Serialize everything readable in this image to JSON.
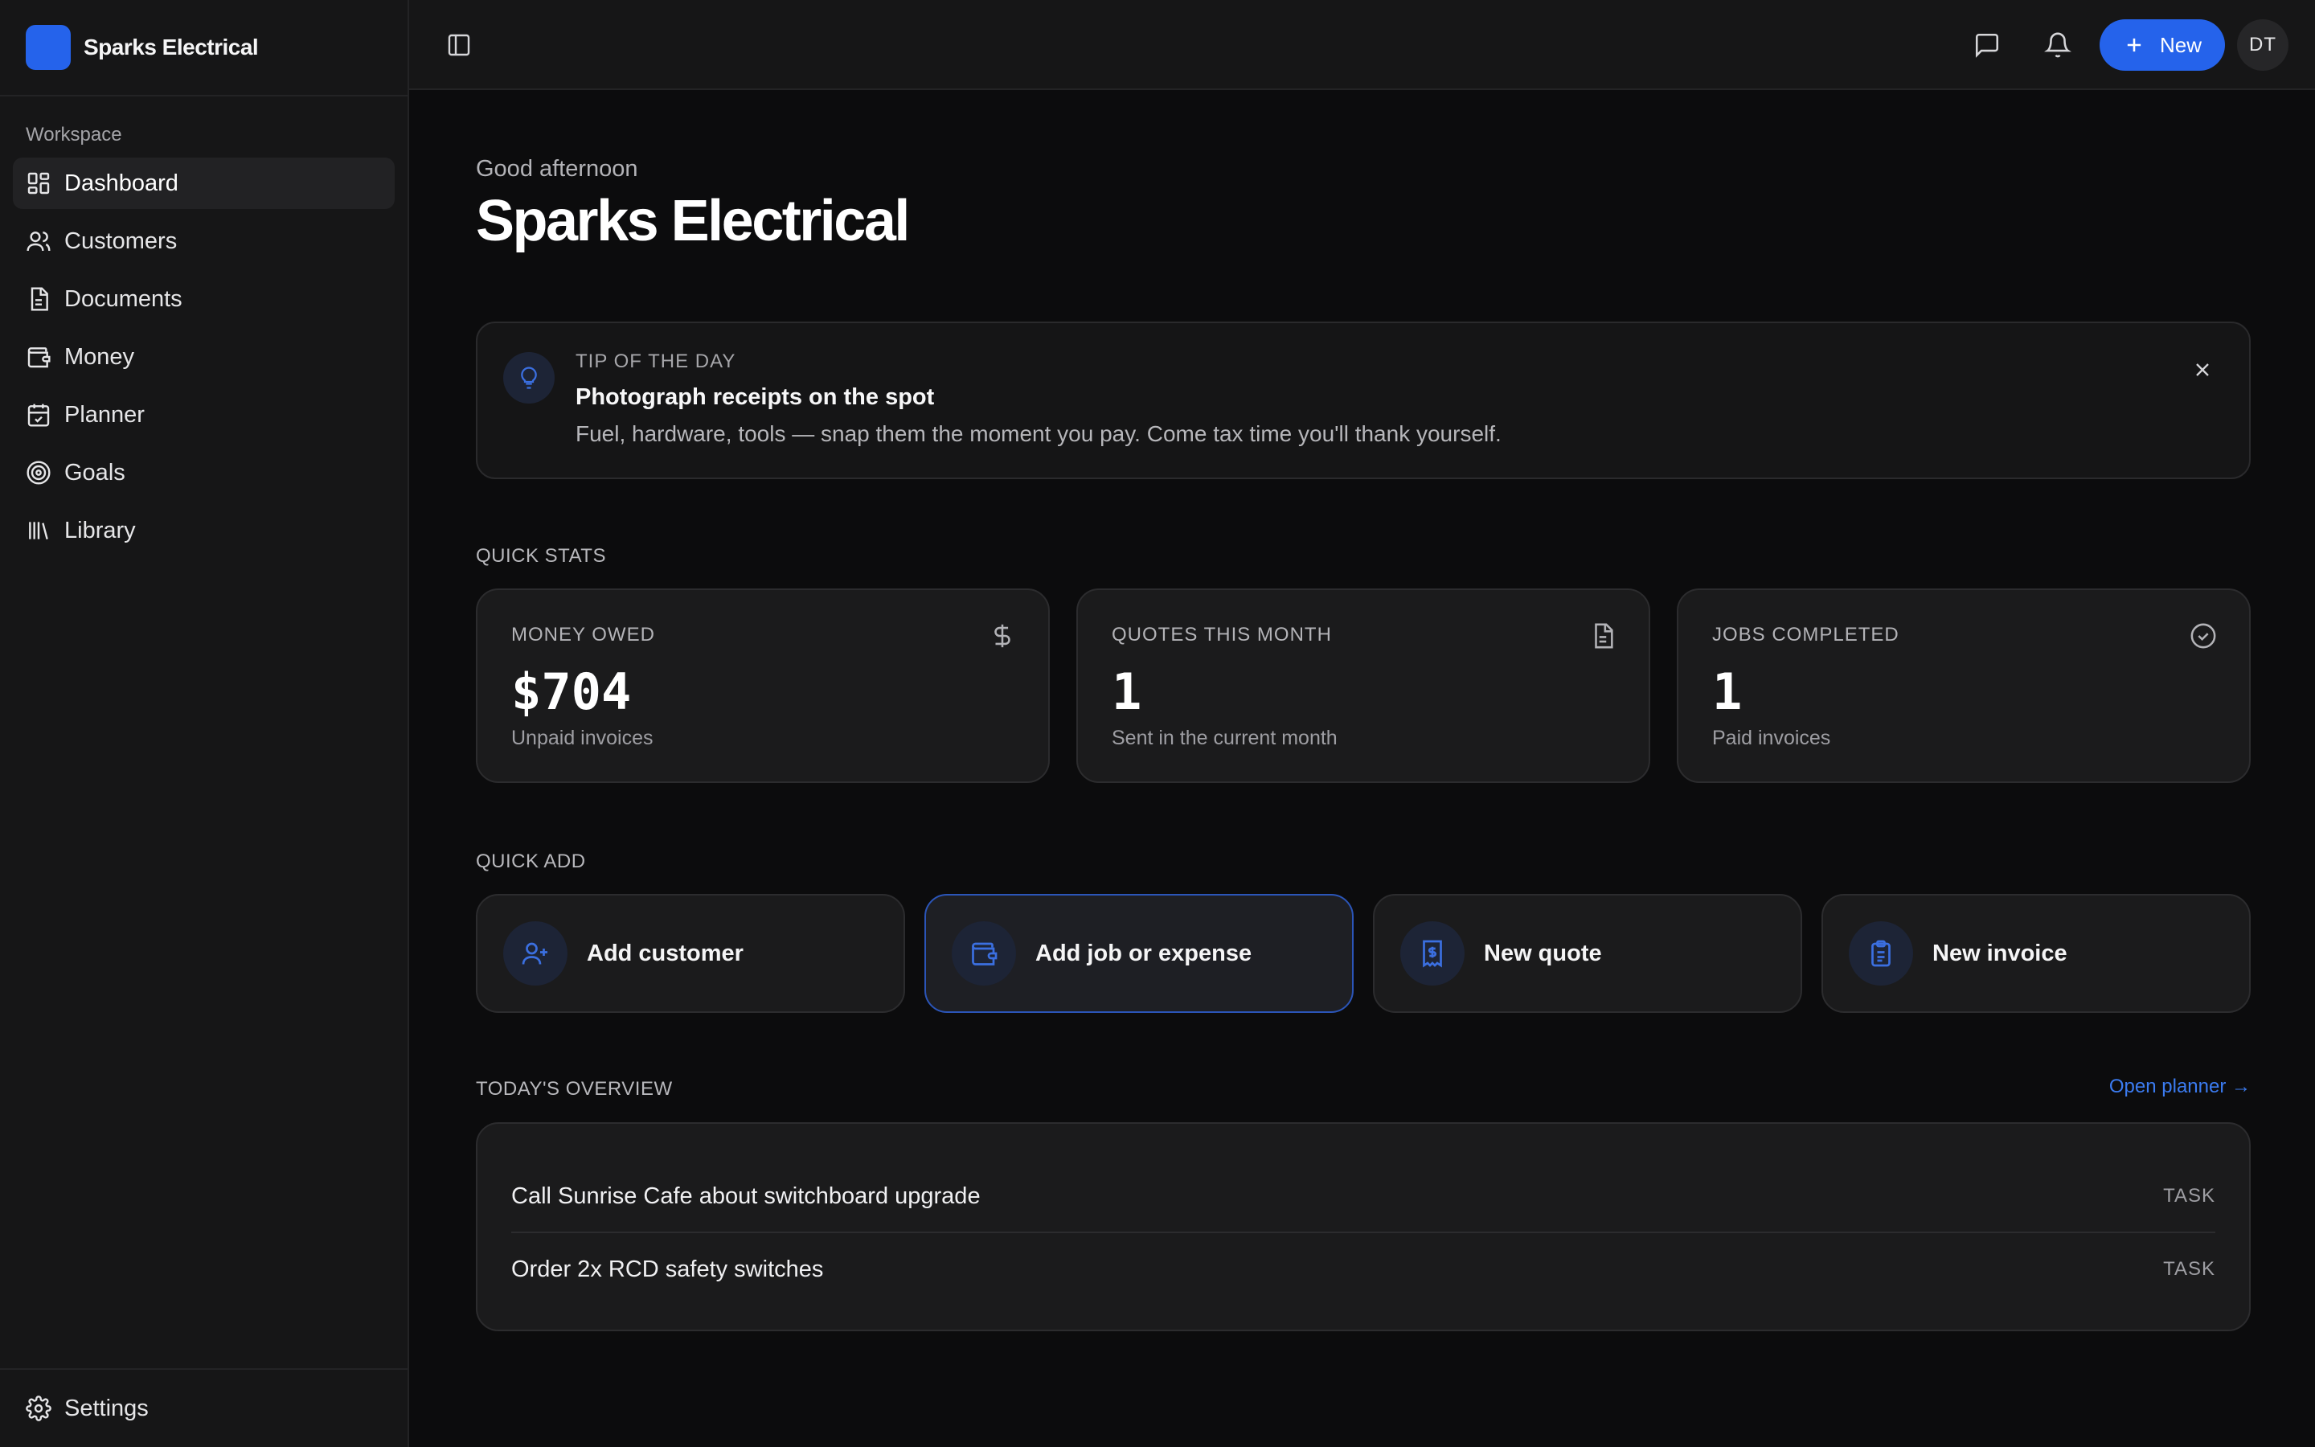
{
  "brand": {
    "name": "Sparks Electrical",
    "color": "#2563eb"
  },
  "sidebar": {
    "section": "Workspace",
    "items": [
      {
        "label": "Dashboard",
        "icon": "dashboard-icon",
        "active": true
      },
      {
        "label": "Customers",
        "icon": "users-icon"
      },
      {
        "label": "Documents",
        "icon": "document-icon"
      },
      {
        "label": "Money",
        "icon": "wallet-icon"
      },
      {
        "label": "Planner",
        "icon": "calendar-check-icon"
      },
      {
        "label": "Goals",
        "icon": "target-icon"
      },
      {
        "label": "Library",
        "icon": "library-icon"
      }
    ],
    "settings_label": "Settings"
  },
  "topbar": {
    "new_label": "New",
    "avatar_initials": "DT"
  },
  "main": {
    "greeting": "Good afternoon",
    "title": "Sparks Electrical",
    "tip": {
      "kicker": "TIP OF THE DAY",
      "title": "Photograph receipts on the spot",
      "text": "Fuel, hardware, tools — snap them the moment you pay. Come tax time you'll thank yourself."
    },
    "quick_stats_label": "QUICK STATS",
    "stats": [
      {
        "label": "MONEY OWED",
        "value": "$704",
        "sub": "Unpaid invoices",
        "icon": "dollar-icon"
      },
      {
        "label": "QUOTES THIS MONTH",
        "value": "1",
        "sub": "Sent in the current month",
        "icon": "file-text-icon"
      },
      {
        "label": "JOBS COMPLETED",
        "value": "1",
        "sub": "Paid invoices",
        "icon": "check-circle-icon"
      }
    ],
    "quick_add_label": "QUICK ADD",
    "quick_add": [
      {
        "label": "Add customer",
        "icon": "user-plus-icon"
      },
      {
        "label": "Add job or expense",
        "icon": "wallet-icon",
        "active": true
      },
      {
        "label": "New quote",
        "icon": "receipt-icon"
      },
      {
        "label": "New invoice",
        "icon": "clipboard-icon"
      }
    ],
    "overview_label": "TODAY'S OVERVIEW",
    "open_planner": "Open planner →",
    "overview": [
      {
        "text": "Call Sunrise Cafe about switchboard upgrade",
        "tag": "TASK"
      },
      {
        "text": "Order 2x RCD safety switches",
        "tag": "TASK"
      }
    ]
  }
}
